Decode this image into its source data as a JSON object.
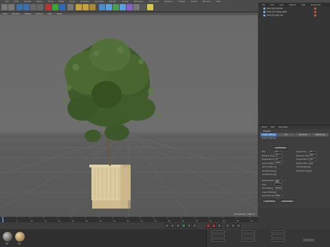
{
  "menubar": [
    "File",
    "Edit",
    "Create",
    "Select",
    "Tools",
    "Mesh",
    "Snap",
    "Animate",
    "Simulate",
    "Render",
    "Sculpt",
    "MoGraph",
    "Character",
    "Pipeline",
    "Plugins",
    "Script",
    "Window",
    "Help"
  ],
  "viewport": {
    "menu": [
      "View",
      "Cameras",
      "Display",
      "Options",
      "Filter",
      "Panel"
    ],
    "grid_spacing": "Grid Spacing : 1000 cm"
  },
  "object_manager": {
    "tabs": [
      "File",
      "Edit",
      "View",
      "Objects",
      "Tags",
      "Bookmarks"
    ],
    "objects": [
      "plant_pot_wooden",
      "plant_01_foliage_2016",
      "plant_01_lsbp_ann"
    ]
  },
  "attribute_manager": {
    "menu": [
      "Mode",
      "Edit",
      "User Data"
    ],
    "title": "Project",
    "tabs": [
      "Project Settings",
      "Info",
      "Dynamics",
      "Referencing"
    ],
    "section": "Project Settings",
    "load_preset_label": "Load Preset",
    "left_params": [
      {
        "label": "FPS",
        "value": "30",
        "type": "value"
      },
      {
        "label": "Minimum Time",
        "value": "0 F",
        "type": "value"
      },
      {
        "label": "Preview Min Time",
        "value": "0 F",
        "type": "value"
      },
      {
        "label": "Level of Detail",
        "value": "100 %",
        "type": "value"
      },
      {
        "label": "Use Animation",
        "value": "",
        "type": "check"
      },
      {
        "label": "Use Generators",
        "value": "",
        "type": "check"
      },
      {
        "label": "Use Deformers",
        "value": "",
        "type": "check"
      }
    ],
    "right_params": [
      {
        "label": "Project Time",
        "value": "0 F",
        "type": "value"
      },
      {
        "label": "Maximum Time",
        "value": "90 F",
        "type": "value"
      },
      {
        "label": "Preview Max Time",
        "value": "90 F",
        "type": "value"
      },
      {
        "label": "Render LOD in Editor",
        "value": "",
        "type": "check"
      },
      {
        "label": "Use Expressions",
        "value": "",
        "type": "check"
      },
      {
        "label": "Use Motion System",
        "value": "",
        "type": "check"
      }
    ],
    "lower_params": [
      {
        "label": "Default Object Color",
        "value": "Gray Blue",
        "type": "value"
      },
      {
        "label": "Color",
        "value": "",
        "type": "value"
      },
      {
        "label": "View Clipping",
        "value": "Medium",
        "type": "value"
      },
      {
        "label": "Linear Workflow",
        "value": "",
        "type": "check"
      },
      {
        "label": "Input Color Profile",
        "value": "sRGB",
        "type": "value"
      }
    ],
    "buttons": [
      "Load Preset",
      "Save Preset"
    ]
  },
  "timeline": {
    "ticks": [
      "0",
      "5",
      "10",
      "15",
      "20",
      "25",
      "30",
      "35",
      "40",
      "45",
      "50",
      "55",
      "60",
      "65",
      "70",
      "75",
      "80",
      "85",
      "90"
    ],
    "current_frame": "0 F"
  },
  "materials": [
    "Mat",
    "Mat"
  ],
  "colors": {
    "accent": "#4d7ab8",
    "pot": "#d8c49a",
    "foliage": "#3d5a28"
  }
}
